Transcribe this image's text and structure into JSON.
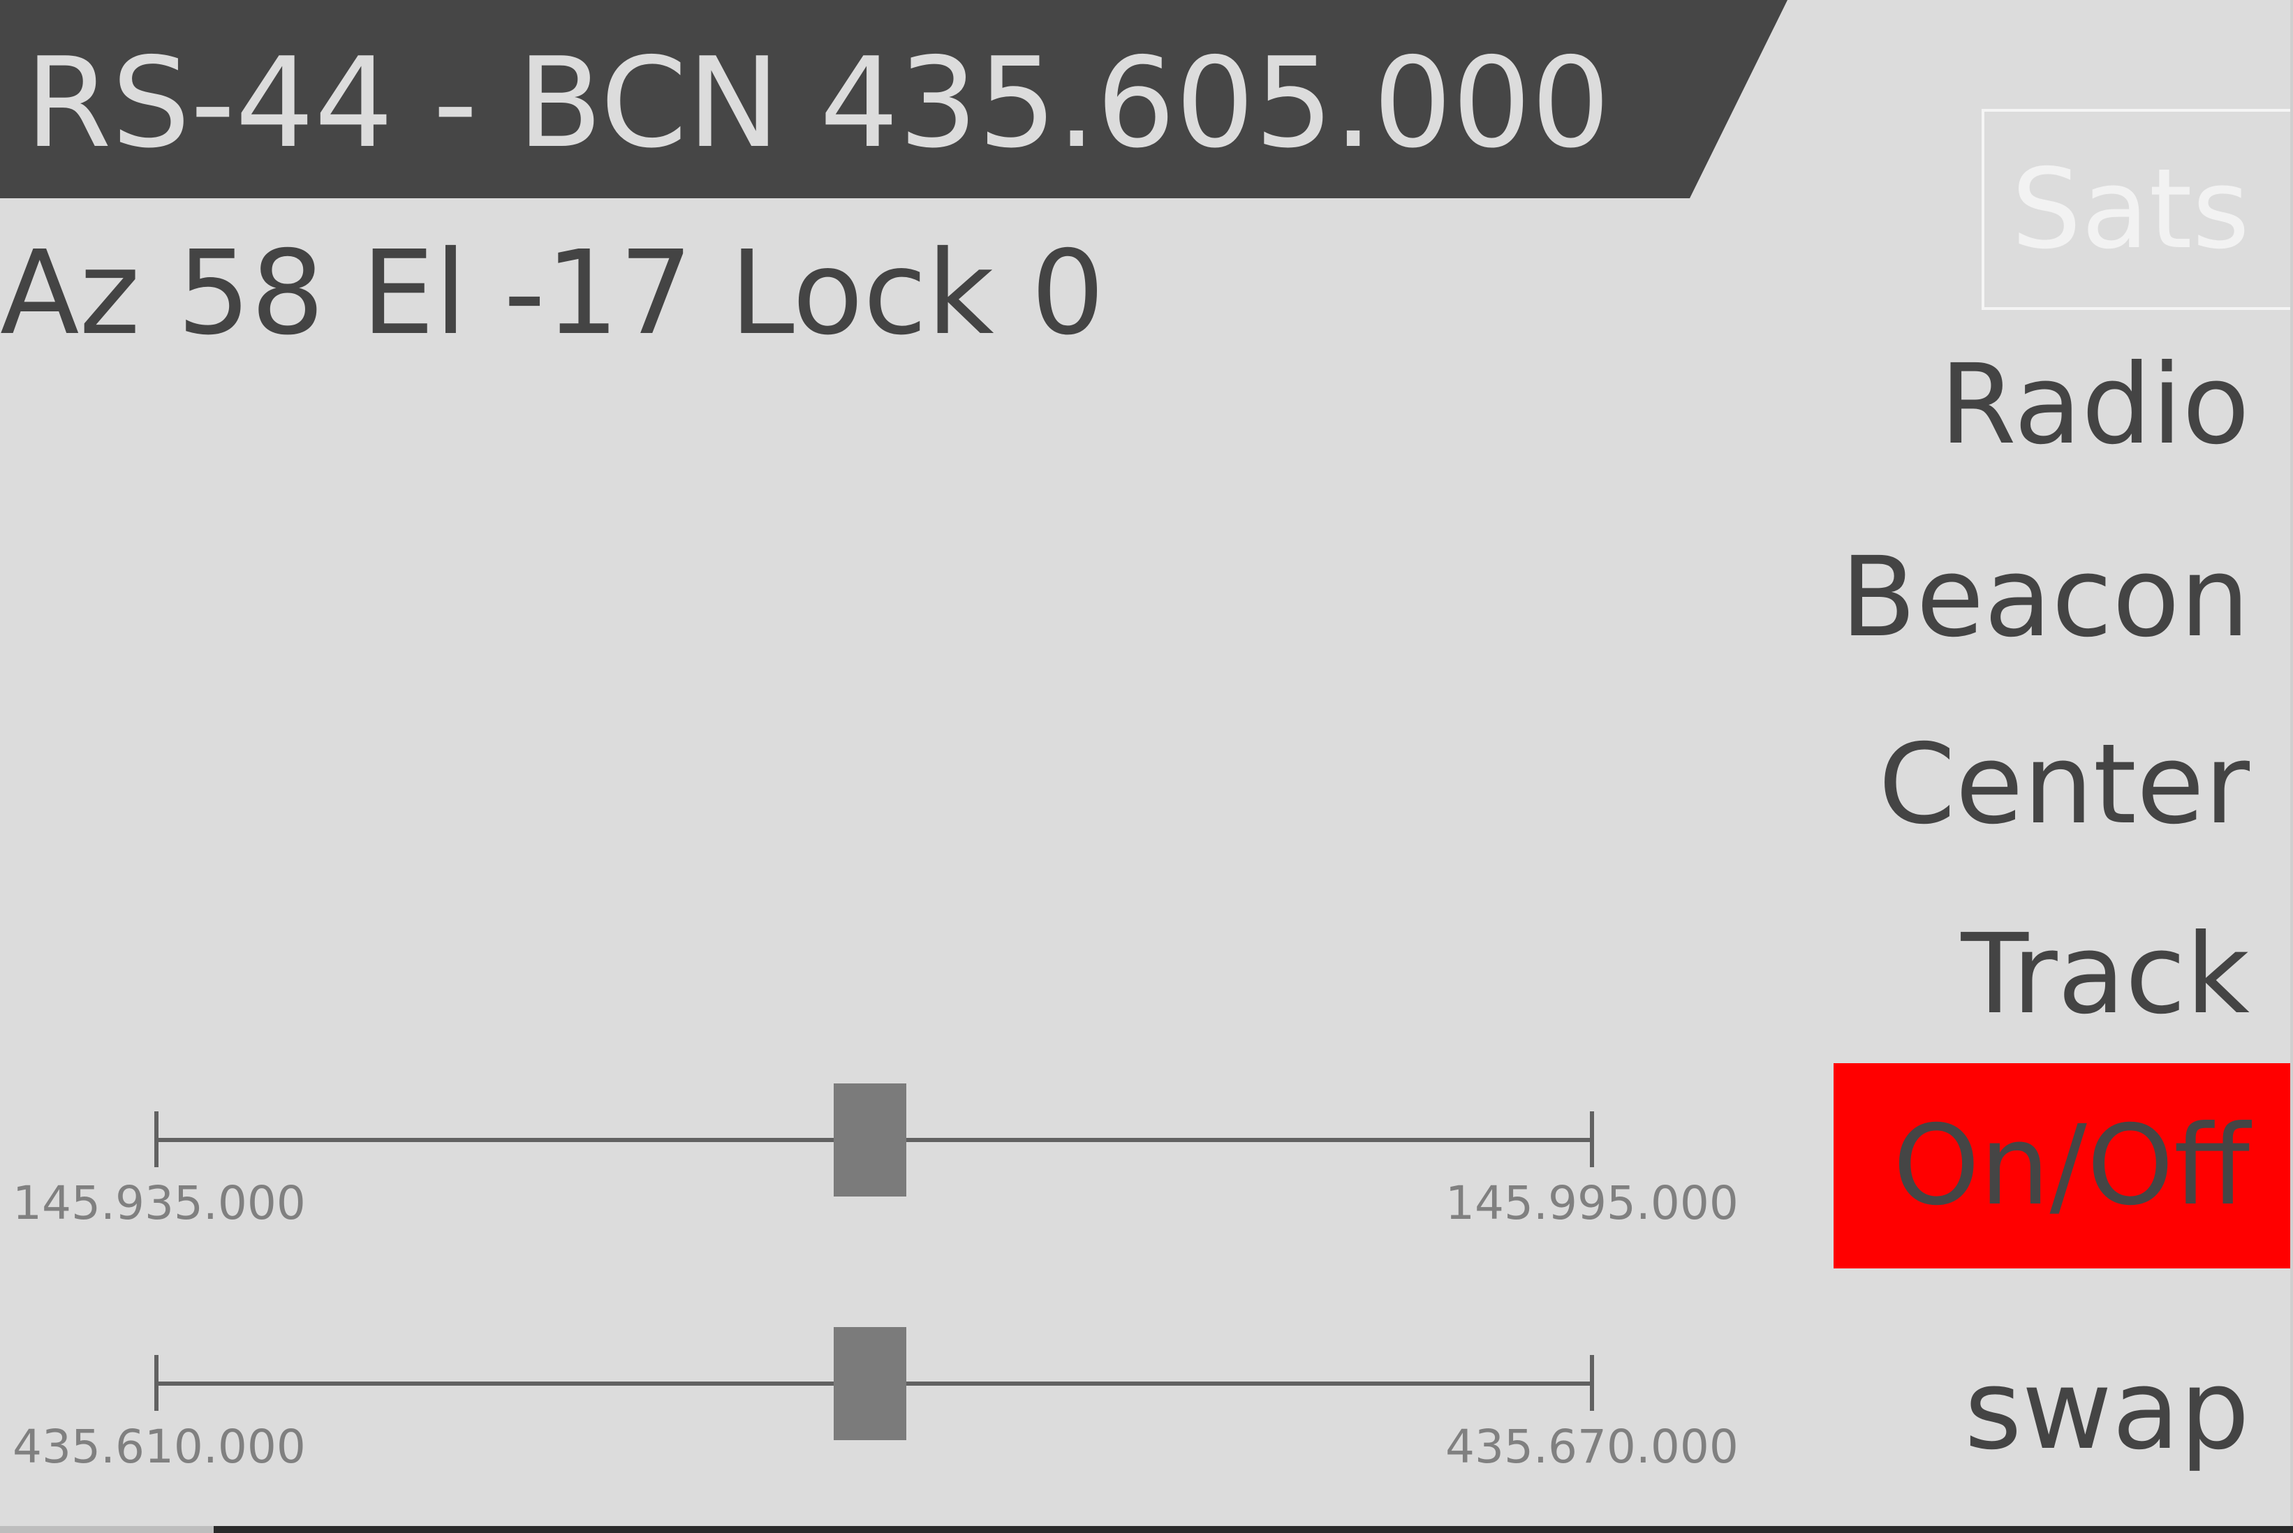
{
  "header": {
    "title": "RS-44 - BCN 435.605.000"
  },
  "status": {
    "text": "Az 58 El -17 Lock 0"
  },
  "menu": {
    "sats": "Sats",
    "radio": "Radio",
    "beacon": "Beacon",
    "center": "Center",
    "track": "Track",
    "on_off": "On/Off",
    "swap": "swap"
  },
  "sliders": [
    {
      "min_label": "145.935.000",
      "max_label": "145.995.000",
      "position": 0.497
    },
    {
      "min_label": "435.610.000",
      "max_label": "435.670.000",
      "position": 0.497
    }
  ],
  "colors": {
    "background": "#dcdcdc",
    "header_bg": "#464646",
    "text": "#444444",
    "on_off_active": "#ff0000",
    "slider_thumb": "#7b7b7b"
  }
}
